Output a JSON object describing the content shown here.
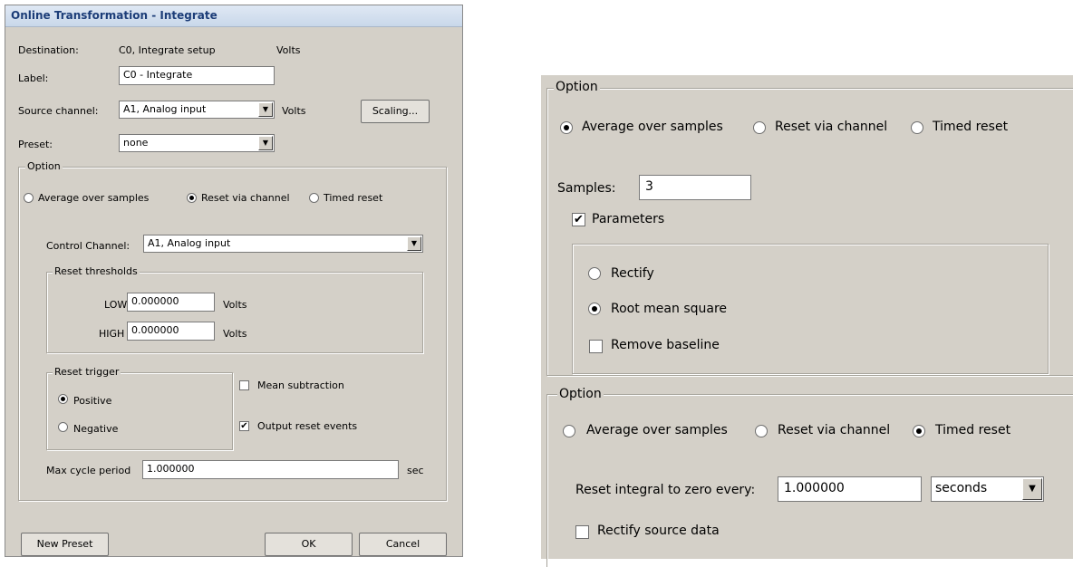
{
  "dialog": {
    "title": "Online Transformation - Integrate",
    "destination_label": "Destination:",
    "destination_value": "C0, Integrate setup",
    "destination_unit": "Volts",
    "label_label": "Label:",
    "label_value": "C0 - Integrate",
    "source_label": "Source channel:",
    "source_value": "A1, Analog input",
    "source_unit": "Volts",
    "scaling_button": "Scaling...",
    "preset_label": "Preset:",
    "preset_value": "none",
    "option_group": {
      "title": "Option",
      "radio_average": "Average over samples",
      "radio_reset_channel": "Reset via channel",
      "radio_timed": "Timed reset",
      "selected": "Reset via channel",
      "control_channel_label": "Control Channel:",
      "control_channel_value": "A1, Analog input",
      "thresholds": {
        "title": "Reset thresholds",
        "low_label": "LOW",
        "low_value": "0.000000",
        "low_unit": "Volts",
        "high_label": "HIGH",
        "high_value": "0.000000",
        "high_unit": "Volts"
      },
      "trigger": {
        "title": "Reset trigger",
        "positive": "Positive",
        "negative": "Negative",
        "selected": "Positive"
      },
      "mean_subtraction": "Mean subtraction",
      "mean_subtraction_checked": false,
      "output_reset_events": "Output reset events",
      "output_reset_events_checked": true,
      "max_cycle_label": "Max cycle period",
      "max_cycle_value": "1.000000",
      "max_cycle_unit": "sec"
    },
    "new_preset_button": "New Preset",
    "ok_button": "OK",
    "cancel_button": "Cancel"
  },
  "panel_average": {
    "title": "Option",
    "radio_average": "Average over samples",
    "radio_reset_channel": "Reset via channel",
    "radio_timed": "Timed reset",
    "selected": "Average over samples",
    "samples_label": "Samples:",
    "samples_value": "3",
    "parameters_label": "Parameters",
    "parameters_checked": true,
    "rectify": "Rectify",
    "rms": "Root mean square",
    "remove_baseline": "Remove baseline",
    "selected_param": "Root mean square",
    "remove_baseline_checked": false
  },
  "panel_timed": {
    "title": "Option",
    "radio_average": "Average over samples",
    "radio_reset_channel": "Reset via channel",
    "radio_timed": "Timed reset",
    "selected": "Timed reset",
    "reset_label": "Reset integral to zero every:",
    "reset_value": "1.000000",
    "unit_value": "seconds",
    "rectify_label": "Rectify source data",
    "rectify_checked": false
  },
  "icons": {
    "dropdown": "chevron-down-icon",
    "check": "checkmark-icon"
  },
  "glyphs": {
    "arrow": "▼",
    "check": "✔"
  }
}
